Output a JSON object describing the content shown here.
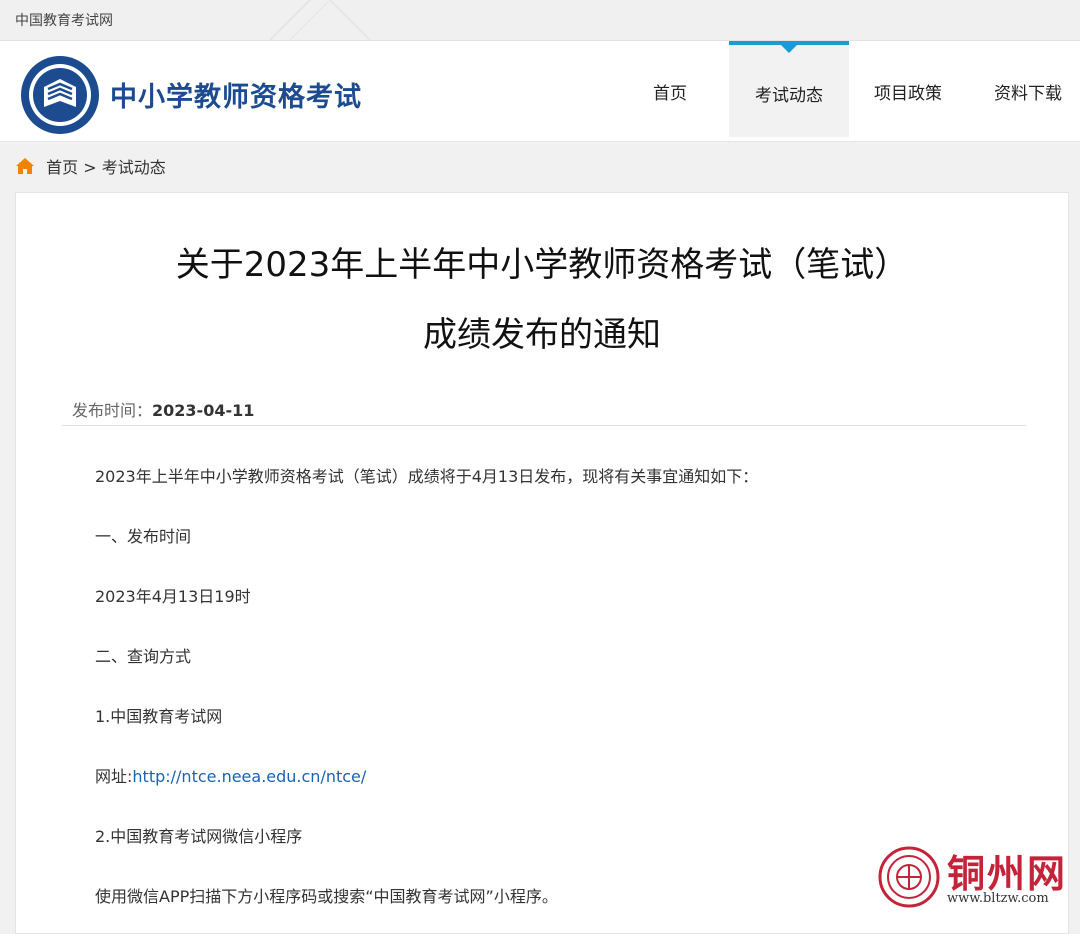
{
  "topbar": {
    "site_name": "中国教育考试网"
  },
  "header": {
    "brand": "中小学教师资格考试",
    "nav": [
      "首页",
      "考试动态",
      "项目政策",
      "资料下载"
    ],
    "active_index": 1,
    "accent_color": "#1d9ad6"
  },
  "breadcrumb": {
    "home": "首页",
    "separator": ">",
    "current": "考试动态"
  },
  "article": {
    "title_line1": "关于2023年上半年中小学教师资格考试（笔试）",
    "title_line2": "成绩发布的通知",
    "date_label": "发布时间：",
    "date_value": "2023-04-11",
    "paragraphs": [
      "2023年上半年中小学教师资格考试（笔试）成绩将于4月13日发布，现将有关事宜通知如下：",
      "一、发布时间",
      "2023年4月13日19时",
      "二、查询方式",
      "1.中国教育考试网",
      "网址:",
      "2.中国教育考试网微信小程序",
      "使用微信APP扫描下方小程序码或搜索“中国教育考试网”小程序。"
    ],
    "url": "http://ntce.neea.edu.cn/ntce/"
  },
  "watermark": {
    "name": "铜州网",
    "url": "www.bltzw.com"
  }
}
